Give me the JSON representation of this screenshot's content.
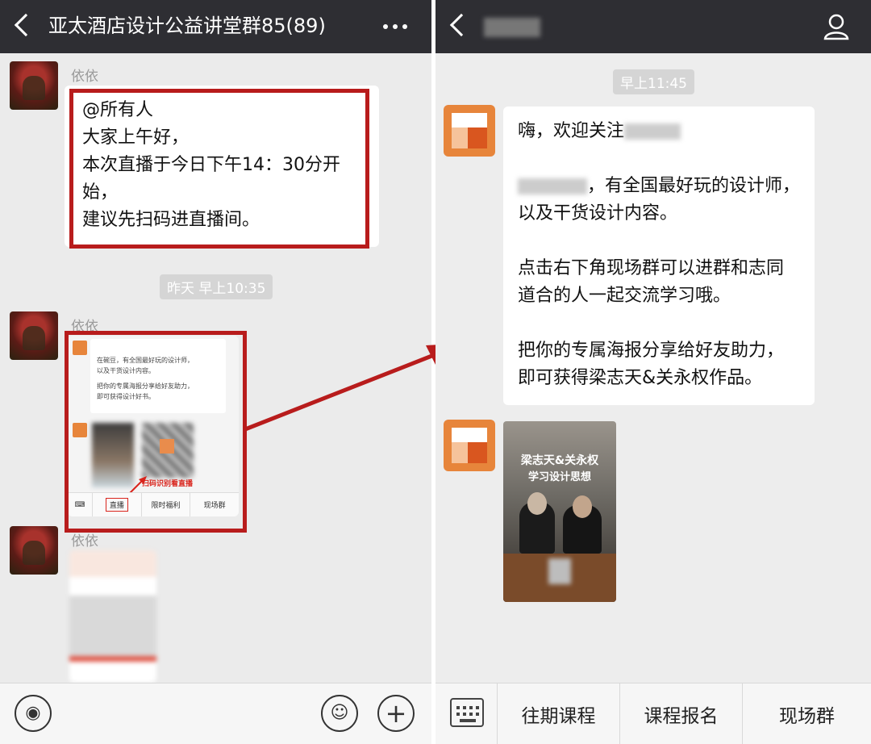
{
  "left": {
    "header": {
      "title": "亚太酒店设计公益讲堂群85(89)"
    },
    "messages": [
      {
        "sender": "依依",
        "text": "@所有人\n大家上午好，\n本次直播于今日下午14：30分开始，\n建议先扫码进直播间。"
      },
      {
        "timestamp": "昨天 早上10:35"
      },
      {
        "sender": "依依",
        "type": "screenshot"
      },
      {
        "sender": "依依",
        "type": "poster"
      }
    ],
    "screenshot": {
      "line1": "在碗豆，有全国最好玩的设计师，",
      "line2": "以及干货设计内容。",
      "line3": "把你的专属海报分享给好友助力，",
      "line4": "即可获得设计好书。",
      "scan_label": "扫码识别看直播",
      "menu": [
        "直播",
        "限时福利",
        "现场群"
      ]
    }
  },
  "right": {
    "timestamp": "早上11:45",
    "bubble": {
      "p1": "嗨，欢迎关注",
      "p2": "，有全国最好玩的设计师，\n以及干货设计内容。",
      "p3": "点击右下角现场群可以进群和志同\n道合的人一起交流学习哦。",
      "p4": "把你的专属海报分享给好友助力，\n即可获得梁志天&关永权作品。"
    },
    "poster": {
      "title1": "梁志天&关永权",
      "title2": "学习设计思想"
    },
    "menu": [
      "往期课程",
      "课程报名",
      "现场群"
    ]
  },
  "colors": {
    "highlight_red": "#b81c1c",
    "header_bg": "#2e2e33",
    "brand_orange": "#e7853b"
  }
}
